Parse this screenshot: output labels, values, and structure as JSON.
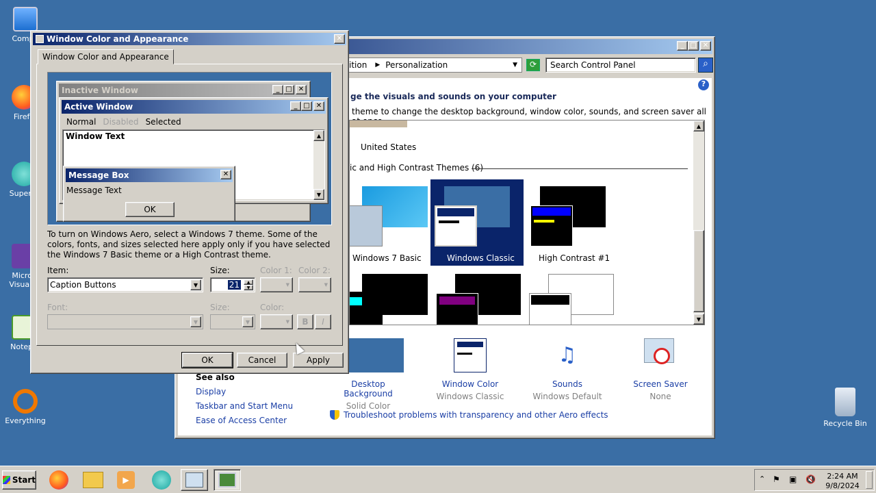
{
  "desktop": {
    "icons": [
      {
        "label": "Compu",
        "color": "#1c6fd1"
      },
      {
        "label": "Firefo",
        "color": "#e66000"
      },
      {
        "label": "Superm",
        "color": "#1aa6a0"
      },
      {
        "label": "Micros\nVisual S",
        "color": "#6a3fa6"
      },
      {
        "label": "Notepa",
        "color": "#4a9a2a"
      },
      {
        "label": "Everything",
        "color": "#f07800"
      }
    ],
    "recycle_bin": "Recycle Bin"
  },
  "personalization": {
    "breadcrumb": {
      "partial": "ition",
      "current": "Personalization"
    },
    "search_placeholder": "Search Control Panel",
    "heading": "ge the visuals and sounds on your computer",
    "subheading": "theme to change the desktop background, window color, sounds, and screen saver all at once.",
    "theme_top_label": "United States",
    "section_title": "ic and High Contrast Themes (6)",
    "themes": [
      {
        "label": "Windows 7 Basic"
      },
      {
        "label": "Windows Classic"
      },
      {
        "label": "High Contrast #1"
      }
    ],
    "bottom_items": [
      {
        "label": "Desktop Background",
        "sub": "Solid Color"
      },
      {
        "label": "Window Color",
        "sub": "Windows Classic"
      },
      {
        "label": "Sounds",
        "sub": "Windows Default"
      },
      {
        "label": "Screen Saver",
        "sub": "None"
      }
    ],
    "see_also": {
      "title": "See also",
      "links": [
        "Display",
        "Taskbar and Start Menu",
        "Ease of Access Center"
      ]
    },
    "troubleshoot": "Troubleshoot problems with transparency and other Aero effects"
  },
  "dialog": {
    "title": "Window Color and Appearance",
    "tab": "Window Color and Appearance",
    "preview": {
      "inactive_title": "Inactive Window",
      "active_title": "Active Window",
      "menu": [
        "Normal",
        "Disabled",
        "Selected"
      ],
      "window_text": "Window Text",
      "msgbox_title": "Message Box",
      "msgbox_text": "Message Text",
      "msgbox_ok": "OK"
    },
    "info": "To turn on Windows Aero, select a Windows 7 theme.  Some of the colors, fonts, and sizes selected here apply only if you have selected the Windows 7 Basic theme or a High Contrast theme.",
    "item_label": "Item:",
    "item_value": "Caption Buttons",
    "size_label": "Size:",
    "size_value": "21",
    "color1_label": "Color 1:",
    "color2_label": "Color 2:",
    "font_label": "Font:",
    "font_size_label": "Size:",
    "font_color_label": "Color:",
    "bold": "B",
    "italic": "I",
    "ok": "OK",
    "cancel": "Cancel",
    "apply": "Apply"
  },
  "taskbar": {
    "start": "Start",
    "time": "2:24 AM",
    "date": "9/8/2024"
  }
}
